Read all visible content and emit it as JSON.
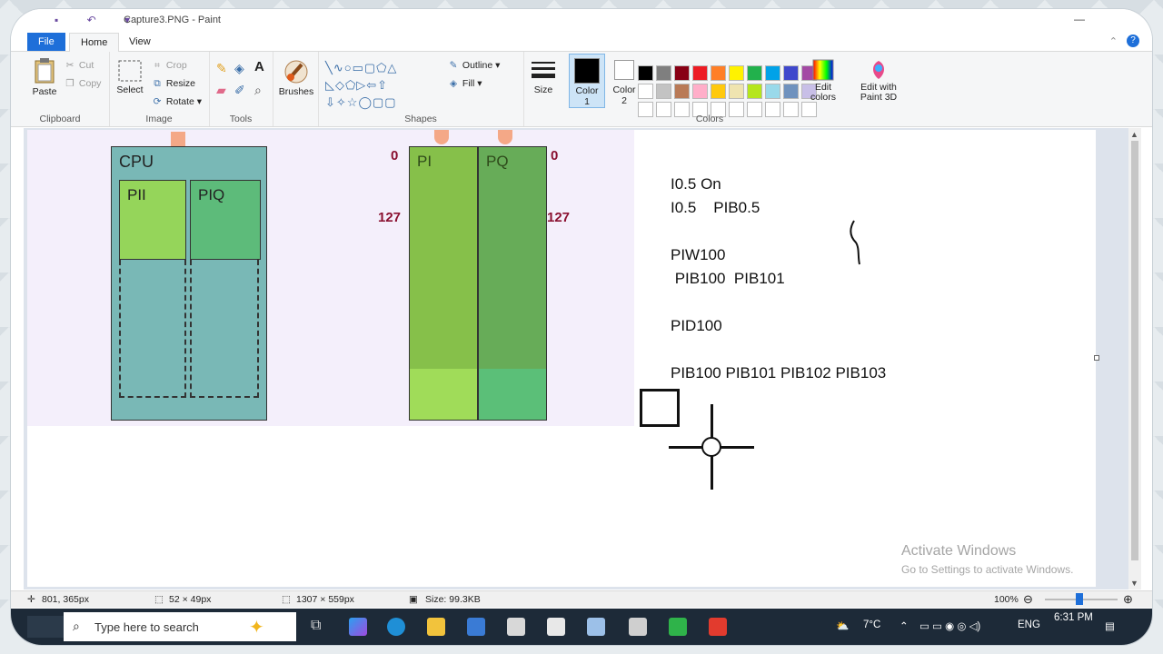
{
  "window": {
    "title": "Capture3.PNG - Paint"
  },
  "tabs": {
    "file": "File",
    "home": "Home",
    "view": "View"
  },
  "ribbon": {
    "clipboard": {
      "paste": "Paste",
      "cut": "Cut",
      "copy": "Copy",
      "label": "Clipboard"
    },
    "image": {
      "select": "Select",
      "crop": "Crop",
      "resize": "Resize",
      "rotate": "Rotate",
      "label": "Image"
    },
    "tools": {
      "label": "Tools"
    },
    "brushes": {
      "label": "Brushes"
    },
    "shapes": {
      "outline": "Outline",
      "fill": "Fill",
      "label": "Shapes"
    },
    "size": {
      "label": "Size"
    },
    "color1": {
      "label": "Color",
      "num": "1"
    },
    "color2": {
      "label": "Color",
      "num": "2"
    },
    "colors": {
      "label": "Colors",
      "edit": "Edit colors",
      "paint3d": "Edit with Paint 3D",
      "row1": [
        "#000000",
        "#7f7f7f",
        "#880015",
        "#ed1c24",
        "#ff7f27",
        "#fff200",
        "#22b14c",
        "#00a2e8",
        "#3f48cc",
        "#a349a4"
      ],
      "row2": [
        "#ffffff",
        "#c3c3c3",
        "#b97a57",
        "#ffaec9",
        "#ffc90e",
        "#efe4b0",
        "#b5e61d",
        "#99d9ea",
        "#7092be",
        "#c8bfe7"
      ]
    }
  },
  "diagram": {
    "cpu": "CPU",
    "pii": "PII",
    "piq": "PIQ",
    "pi": "PI",
    "pq": "PQ",
    "zero_left": "0",
    "zero_right": "0",
    "n127_left": "127",
    "n127_right": "127"
  },
  "notes": {
    "line1": "I0.5 On",
    "line2": "I0.5    PIB0.5",
    "line3": "PIW100",
    "line4": " PIB100  PIB101",
    "line5": "PID100",
    "line6": "PIB100 PIB101 PIB102 PIB103"
  },
  "watermark": {
    "line1": "Activate Windows",
    "line2": "Go to Settings to activate Windows."
  },
  "status": {
    "cursor_pos": "801, 365px",
    "selection_size": "52 × 49px",
    "image_size": "1307 × 559px",
    "file_size": "Size: 99.3KB",
    "zoom": "100%"
  },
  "taskbar": {
    "search_placeholder": "Type here to search",
    "temperature": "7°C",
    "language": "ENG",
    "time": "6:31 PM"
  }
}
